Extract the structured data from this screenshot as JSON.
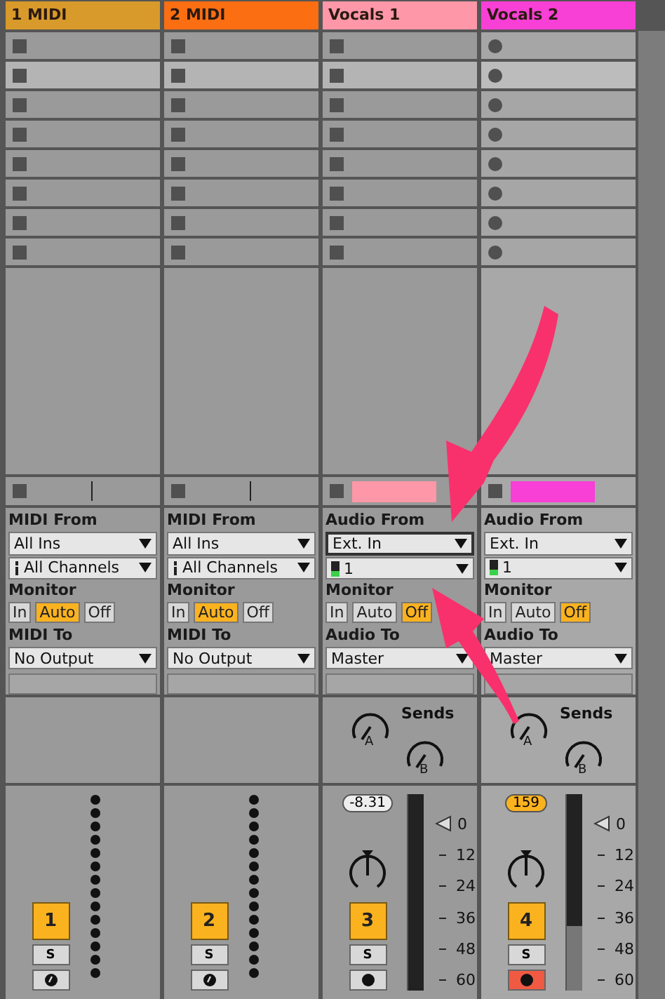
{
  "clip_rows": [
    {
      "selected": false
    },
    {
      "selected": true
    },
    {
      "selected": false
    },
    {
      "selected": false
    },
    {
      "selected": false
    },
    {
      "selected": false
    },
    {
      "selected": false
    },
    {
      "selected": false
    }
  ],
  "tracks": [
    {
      "name": "1 MIDI",
      "kind": "midi",
      "color": "#d89a2a",
      "selected": false,
      "armed": false,
      "io": {
        "from_label": "MIDI From",
        "from": "All Ins",
        "channel": "All Channels",
        "monitor_label": "Monitor",
        "monitor": [
          {
            "label": "In",
            "selected": false
          },
          {
            "label": "Auto",
            "selected": true
          },
          {
            "label": "Off",
            "selected": false
          }
        ],
        "to_label": "MIDI To",
        "to": "No Output"
      },
      "number": "1",
      "solo": "S"
    },
    {
      "name": "2 MIDI",
      "kind": "midi",
      "color": "#fb6e12",
      "selected": false,
      "armed": false,
      "io": {
        "from_label": "MIDI From",
        "from": "All Ins",
        "channel": "All Channels",
        "monitor_label": "Monitor",
        "monitor": [
          {
            "label": "In",
            "selected": false
          },
          {
            "label": "Auto",
            "selected": true
          },
          {
            "label": "Off",
            "selected": false
          }
        ],
        "to_label": "MIDI To",
        "to": "No Output"
      },
      "number": "2",
      "solo": "S"
    },
    {
      "name": "Vocals 1",
      "kind": "audio",
      "color": "#fe97a8",
      "selected": false,
      "armed": false,
      "io": {
        "from_label": "Audio From",
        "from": "Ext. In",
        "channel": "1",
        "monitor_label": "Monitor",
        "monitor": [
          {
            "label": "In",
            "selected": false
          },
          {
            "label": "Auto",
            "selected": false
          },
          {
            "label": "Off",
            "selected": true
          }
        ],
        "to_label": "Audio To",
        "to": "Master"
      },
      "sends_label": "Sends",
      "send_knobs": [
        "A",
        "B"
      ],
      "volume": "-8.31",
      "volume_highlighted": false,
      "scale": [
        "0",
        "12",
        "24",
        "36",
        "48",
        "60"
      ],
      "number": "3",
      "solo": "S"
    },
    {
      "name": "Vocals 2",
      "kind": "audio",
      "color": "#f83fd6",
      "selected": true,
      "armed": true,
      "io": {
        "from_label": "Audio From",
        "from": "Ext. In",
        "channel": "1",
        "monitor_label": "Monitor",
        "monitor": [
          {
            "label": "In",
            "selected": false
          },
          {
            "label": "Auto",
            "selected": false
          },
          {
            "label": "Off",
            "selected": true
          }
        ],
        "to_label": "Audio To",
        "to": "Master"
      },
      "sends_label": "Sends",
      "send_knobs": [
        "A",
        "B"
      ],
      "volume": "159",
      "volume_highlighted": true,
      "meter": {
        "level": 0.33
      },
      "scale": [
        "0",
        "12",
        "24",
        "36",
        "48",
        "60"
      ],
      "number": "4",
      "solo": "S"
    }
  ]
}
